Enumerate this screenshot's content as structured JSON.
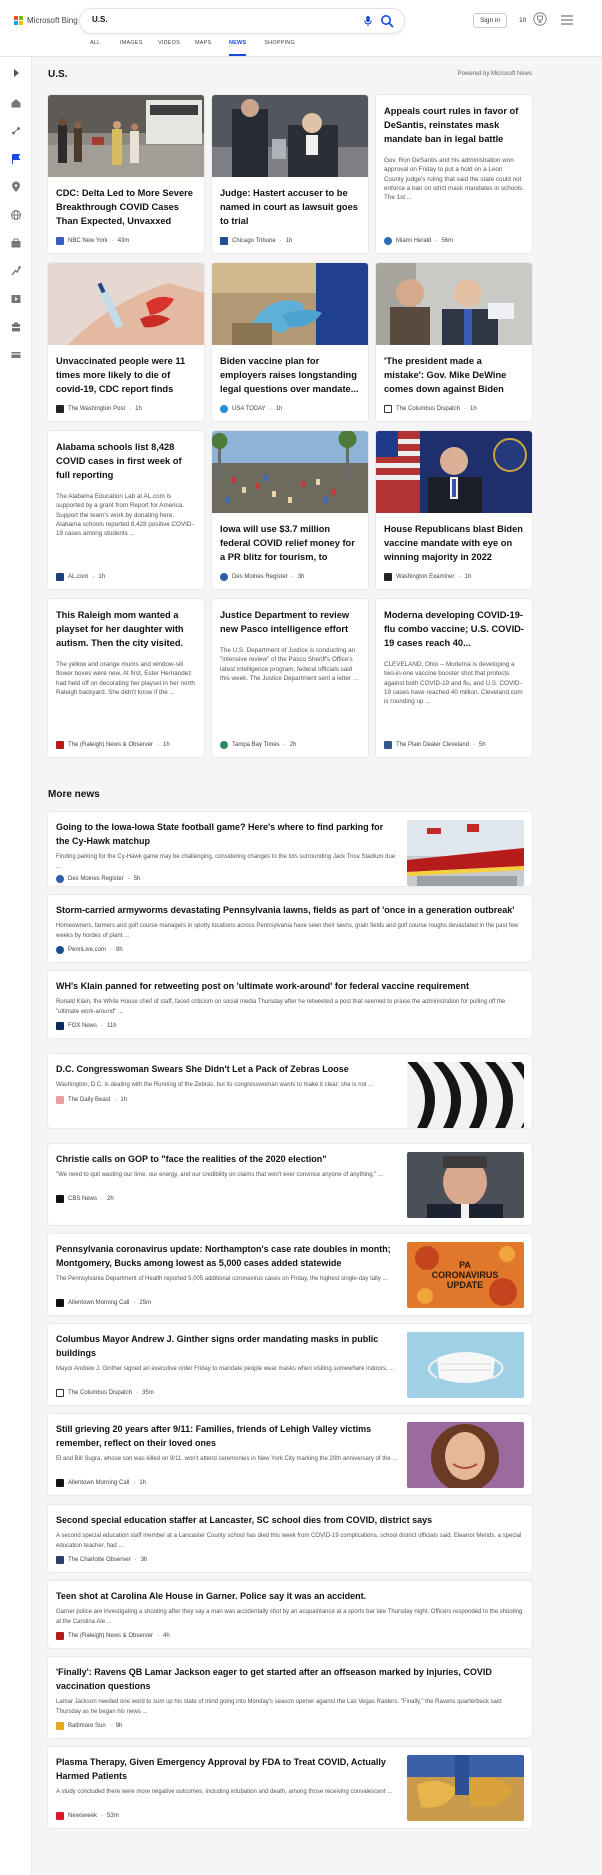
{
  "brand": {
    "name": "Microsoft Bing"
  },
  "search": {
    "value": "U.S."
  },
  "header": {
    "signin_label": "Sign in",
    "points": "10"
  },
  "tabs": [
    "ALL",
    "IMAGES",
    "VIDEOS",
    "MAPS",
    "NEWS",
    "SHOPPING"
  ],
  "active_tab": "NEWS",
  "section": {
    "title": "U.S.",
    "powered_by": "Powered by Microsoft News"
  },
  "cards": [
    {
      "title": "CDC: Delta Led to More Severe Breakthrough COVID Cases Than Expected, Unvaxxed Still...",
      "snippet": "",
      "source": "NBC New York",
      "time": "43m",
      "source_color": "#3a5bbf",
      "image": "street"
    },
    {
      "title": "Judge: Hastert accuser to be named in court as lawsuit goes to trial",
      "snippet": "",
      "source": "Chicago Tribune",
      "time": "1h",
      "source_color": "#1d4f91",
      "image": "courthouse"
    },
    {
      "title": "Appeals court rules in favor of DeSantis, reinstates mask mandate ban in legal battle",
      "snippet": "Gov. Ron DeSantis and his administration won approval on Friday to put a hold on a Leon County judge's ruling that said the state could not enforce a ban on strict mask mandates in schools. The 1st ...",
      "source": "Miami Herald",
      "time": "56m",
      "source_color": "#2c6fb7",
      "image": ""
    },
    {
      "title": "Unvaccinated people were 11 times more likely to die of covid-19, CDC report finds",
      "snippet": "",
      "source": "The Washington Post",
      "time": "1h",
      "source_color": "#222222",
      "image": "vaccine"
    },
    {
      "title": "Biden vaccine plan for employers raises longstanding legal questions over mandate...",
      "snippet": "",
      "source": "USA TODAY",
      "time": "1h",
      "source_color": "#1e8ee0",
      "image": "gloves"
    },
    {
      "title": "'The president made a mistake': Gov. Mike DeWine comes down against Biden vaccine order",
      "snippet": "",
      "source": "The Columbus Dispatch",
      "time": "1h",
      "source_color": "#333333",
      "image": "dewine"
    },
    {
      "title": "Alabama schools list 8,428 COVID cases in first week of full reporting",
      "snippet": "The Alabama Education Lab at AL.com is supported by a grant from Report for America. Support the team's work by donating here. Alabama schools reported 8,428 positive COVID-19 cases among students ...",
      "source": "AL.com",
      "time": "1h",
      "source_color": "#1b3f7a",
      "image": ""
    },
    {
      "title": "Iowa will use $3.7 million federal COVID relief money for a PR blitz for tourism, to recru...",
      "snippet": "",
      "source": "Des Moines Register",
      "time": "3h",
      "source_color": "#2f5ca8",
      "image": "fair"
    },
    {
      "title": "House Republicans blast Biden vaccine mandate with eye on winning majority in 2022",
      "snippet": "",
      "source": "Washington Examiner",
      "time": "1h",
      "source_color": "#222222",
      "image": "mccarthy"
    },
    {
      "title": "This Raleigh mom wanted a playset for her daughter with autism. Then the city visited.",
      "snippet": "The yellow and orange mums and window-sill flower boxes were new. At first, Ester Hernandez had held off on decorating her playset in her north Raleigh backyard. She didn't know if the ...",
      "source": "The (Raleigh) News & Observer",
      "time": "1h",
      "source_color": "#b71c1c",
      "image": ""
    },
    {
      "title": "Justice Department to review new Pasco intelligence effort",
      "snippet": "The U.S. Department of Justice is conducting an \"intensive review\" of the Pasco Sheriff's Office's latest intelligence program, federal officials said this week. The Justice Department sent a letter ...",
      "source": "Tampa Bay Times",
      "time": "2h",
      "source_color": "#2a8c5a",
      "image": ""
    },
    {
      "title": "Moderna developing COVID-19-flu combo vaccine; U.S. COVID-19 cases reach 40...",
      "snippet": "CLEVELAND, Ohio -- Moderna is developing a two-in-one vaccine booster shot that protects against both COVID-19 and flu, and U.S. COVID-19 cases have reached 40 million. Cleveland.com is rounding up ...",
      "source": "The Plain Dealer Cleveland",
      "time": "5h",
      "source_color": "#335a8a",
      "image": ""
    }
  ],
  "more_news": {
    "title": "More news",
    "items": [
      {
        "title": "Going to the Iowa-Iowa State football game? Here's where to find parking for the Cy-Hawk matchup",
        "snippet": "Finding parking for the Cy-Hawk game may be challenging, considering changes to the lots surrounding Jack Trice Stadium due ...",
        "source": "Des Moines Register",
        "time": "5h",
        "source_color": "#2f5ca8",
        "image": "stadium"
      },
      {
        "title": "Storm-carried armyworms devastating Pennsylvania lawns, fields as part of 'once in a generation outbreak'",
        "snippet": "Homeowners, farmers and golf course managers in spotty locations across Pennsylvania have seen their lawns, grain fields and golf course roughs devastated in the past few weeks by hordes of plant ...",
        "source": "PennLive.com",
        "time": "8h",
        "source_color": "#1c4f8c",
        "image": ""
      },
      {
        "title": "WH's Klain panned for retweeting post on 'ultimate work-around' for federal vaccine requirement",
        "snippet": "Ronald Klain, the White House chief of staff, faced criticism on social media Thursday after he retweeted a post that seemed to praise the administration for pulling off the \"ultimate work-around\" ...",
        "source": "FOX News",
        "time": "11h",
        "source_color": "#0b2a5b",
        "image": ""
      },
      {
        "title": "D.C. Congresswoman Swears She Didn't Let a Pack of Zebras Loose",
        "snippet": "Washington, D.C. is dealing with the Running of the Zebras, but its congresswoman wants to make it clear: she is not ...",
        "source": "The Daily Beast",
        "time": "1h",
        "source_color": "#e8a0a0",
        "image": "zebra"
      },
      {
        "title": "Christie calls on GOP to \"face the realities of the 2020 election\"",
        "snippet": "\"We need to quit wasting our time, our energy, and our credibility on claims that won't ever convince anyone of anything,\" ...",
        "source": "CBS News",
        "time": "2h",
        "source_color": "#111111",
        "image": "christie"
      },
      {
        "title": "Pennsylvania coronavirus update: Northampton's case rate doubles in month; Montgomery, Bucks among lowest as 5,000 cases added statewide",
        "snippet": "The Pennsylvania Department of Health reported 5,005 additional coronavirus cases on Friday, the highest single-day tally ...",
        "source": "Allentown Morning Call",
        "time": "25m",
        "source_color": "#111111",
        "image": "virus",
        "image_text": "PA CORONAVIRUS UPDATE"
      },
      {
        "title": "Columbus Mayor Andrew J. Ginther signs order mandating masks in public buildings",
        "snippet": "Mayor Andrew J. Ginther signed an executive order Friday to mandate people wear masks when visiting somewhere indoors, ...",
        "source": "The Columbus Dispatch",
        "time": "35m",
        "source_color": "#333333",
        "image": "mask"
      },
      {
        "title": "Still grieving 20 years after 9/11: Families, friends of Lehigh Valley victims remember, reflect on their loved ones",
        "snippet": "El and Bill Sugra, whose son was killed on 9/11, won't attend ceremonies in New York City marking the 20th anniversary of the ...",
        "source": "Allentown Morning Call",
        "time": "1h",
        "source_color": "#111111",
        "image": "woman"
      },
      {
        "title": "Second special education staffer at Lancaster, SC school dies from COVID, district says",
        "snippet": "A second special education staff member at a Lancaster County school has died this week from COVID-19 complications, school district officials said. Eleanor Mends, a special education teacher, had ...",
        "source": "The Charlotte Observer",
        "time": "3h",
        "source_color": "#2a3f6b",
        "image": ""
      },
      {
        "title": "Teen shot at Carolina Ale House in Garner. Police say it was an accident.",
        "snippet": "Garner police are investigating a shooting after they say a man was accidentally shot by an acquaintance at a sports bar late Thursday night. Officers responded to the shooting at the Carolina Ale ...",
        "source": "The (Raleigh) News & Observer",
        "time": "4h",
        "source_color": "#b71c1c",
        "image": ""
      },
      {
        "title": "'Finally': Ravens QB Lamar Jackson eager to get started after an offseason marked by injuries, COVID vaccination questions",
        "snippet": "Lamar Jackson needed one word to sum up his state of mind going into Monday's season opener against the Las Vegas Raiders. \"Finally,\" the Ravens quarterback said Thursday as he began his news ...",
        "source": "Baltimore Sun",
        "time": "9h",
        "source_color": "#e8a81c",
        "image": ""
      },
      {
        "title": "Plasma Therapy, Given Emergency Approval by FDA to Treat COVID, Actually Harmed Patients",
        "snippet": "A study concluded there were more negative outcomes, including intubation and death, among those receiving convalescent ...",
        "source": "Newsweek",
        "time": "53m",
        "source_color": "#d7192a",
        "image": "plasma"
      }
    ]
  },
  "colors": {
    "accent": "#174ae4",
    "page_bg": "#f5f5f5",
    "card_bg": "#ffffff"
  },
  "icons": {
    "search": "search-icon",
    "mic": "mic-icon",
    "rewards": "trophy-icon",
    "menu": "hamburger-menu-icon"
  }
}
